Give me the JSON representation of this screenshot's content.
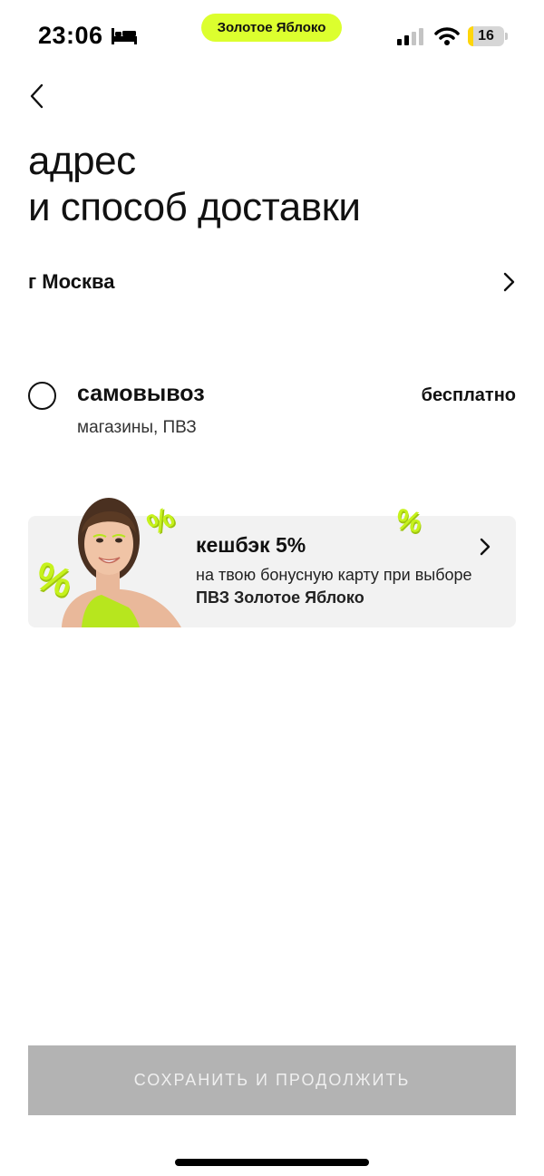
{
  "status_bar": {
    "time": "23:06",
    "app_pill": "Золотое Яблоко",
    "battery_level": "16",
    "battery_fraction": 0.16,
    "icons": [
      "bed-icon",
      "signal-icon",
      "wifi-icon",
      "battery-icon"
    ]
  },
  "header": {
    "back_icon": "chevron-left-icon",
    "title_line1": "адрес",
    "title_line2": "и способ доставки"
  },
  "city": {
    "label": "г Москва",
    "icon": "chevron-right-icon"
  },
  "delivery_option": {
    "title": "самовывоз",
    "subtitle": "магазины, ПВЗ",
    "price": "бесплатно",
    "selected": false
  },
  "promo": {
    "title": "кешбэк 5%",
    "text": "на твою бонусную карту при выборе",
    "text_bold": "ПВЗ Золотое Яблоко",
    "icon": "chevron-right-icon",
    "accent_color": "#c6f21c"
  },
  "footer": {
    "save_label": "СОХРАНИТЬ И ПРОДОЛЖИТЬ"
  },
  "colors": {
    "accent": "#dcff2e",
    "button_disabled": "#b3b3b3",
    "banner_bg": "#f2f2f2"
  }
}
